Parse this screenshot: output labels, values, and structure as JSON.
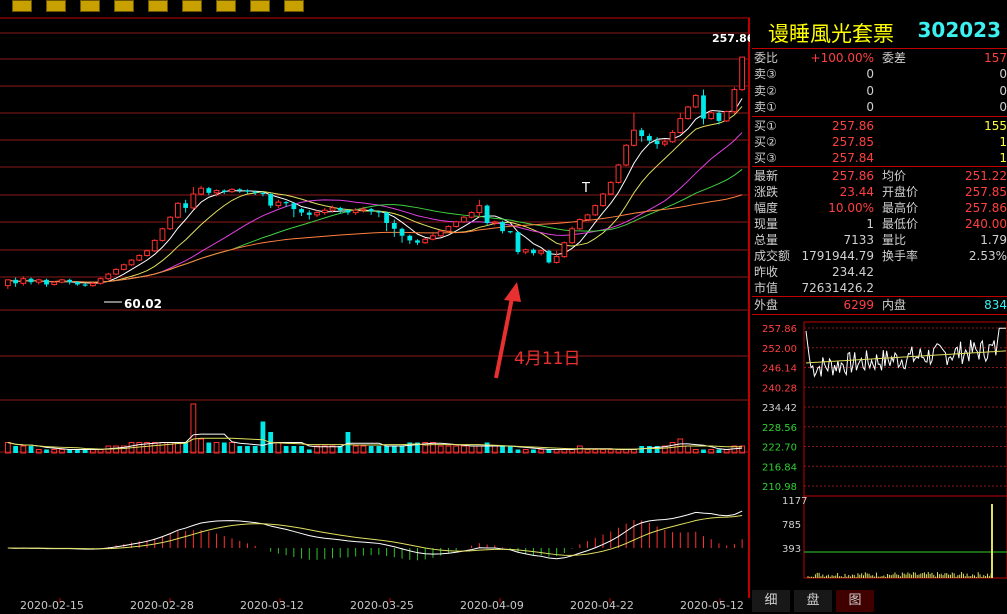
{
  "toolbar": {
    "buttons": [
      "1",
      "3",
      "5",
      "15",
      "30",
      "60",
      "日",
      "周",
      "月"
    ]
  },
  "chart_data": [
    {
      "type": "candlestick",
      "title": "",
      "x_ticks": [
        "2020-02-15",
        "2020-02-28",
        "2020-03-12",
        "2020-03-25",
        "2020-04-09",
        "2020-04-22",
        "2020-05-12"
      ],
      "annotations": {
        "low_label": "60.02",
        "high_label": "257.86",
        "arrow_text": "4月11日",
        "t_mark": "T"
      },
      "ylim": [
        40,
        290
      ],
      "candles": [
        [
          61,
          66,
          58,
          65
        ],
        [
          66,
          63,
          60,
          68
        ],
        [
          63,
          67,
          61,
          69
        ],
        [
          67,
          64,
          62,
          68
        ],
        [
          64,
          66,
          62,
          67
        ],
        [
          66,
          62,
          60,
          67
        ],
        [
          62,
          64,
          61,
          65
        ],
        [
          64,
          66,
          63,
          67
        ],
        [
          66,
          64,
          62,
          67
        ],
        [
          64,
          62,
          61,
          65
        ],
        [
          62,
          61,
          60,
          63
        ],
        [
          61,
          63,
          60,
          64
        ],
        [
          63,
          67,
          62,
          68
        ],
        [
          67,
          71,
          66,
          72
        ],
        [
          71,
          75,
          70,
          76
        ],
        [
          75,
          79,
          74,
          80
        ],
        [
          79,
          83,
          78,
          84
        ],
        [
          83,
          87,
          82,
          88
        ],
        [
          87,
          91,
          86,
          92
        ],
        [
          91,
          100,
          90,
          101
        ],
        [
          100,
          110,
          99,
          111
        ],
        [
          110,
          120,
          109,
          121
        ],
        [
          120,
          132,
          119,
          133
        ],
        [
          132,
          128,
          124,
          135
        ],
        [
          128,
          140,
          127,
          146
        ],
        [
          140,
          145,
          139,
          147
        ],
        [
          145,
          141,
          139,
          146
        ],
        [
          141,
          143,
          138,
          144
        ],
        [
          143,
          142,
          140,
          144
        ],
        [
          142,
          144,
          141,
          145
        ],
        [
          144,
          143,
          141,
          145
        ],
        [
          143,
          142,
          140,
          144
        ],
        [
          142,
          141,
          139,
          143
        ],
        [
          141,
          140,
          138,
          142
        ],
        [
          140,
          130,
          128,
          141
        ],
        [
          130,
          133,
          128,
          135
        ],
        [
          133,
          132,
          129,
          134
        ],
        [
          132,
          127,
          120,
          133
        ],
        [
          127,
          124,
          121,
          128
        ],
        [
          124,
          122,
          118,
          126
        ],
        [
          122,
          124,
          120,
          126
        ],
        [
          124,
          126,
          122,
          128
        ],
        [
          126,
          128,
          124,
          130
        ],
        [
          128,
          126,
          123,
          129
        ],
        [
          126,
          124,
          122,
          127
        ],
        [
          124,
          126,
          122,
          128
        ],
        [
          126,
          127,
          124,
          129
        ],
        [
          127,
          125,
          122,
          128
        ],
        [
          125,
          124,
          120,
          126
        ],
        [
          124,
          115,
          108,
          125
        ],
        [
          115,
          110,
          103,
          118
        ],
        [
          110,
          104,
          98,
          111
        ],
        [
          104,
          100,
          97,
          105
        ],
        [
          100,
          98,
          96,
          101
        ],
        [
          98,
          101,
          97,
          102
        ],
        [
          101,
          104,
          100,
          106
        ],
        [
          104,
          108,
          103,
          109
        ],
        [
          108,
          112,
          107,
          113
        ],
        [
          112,
          116,
          111,
          117
        ],
        [
          116,
          120,
          115,
          121
        ],
        [
          120,
          124,
          119,
          125
        ],
        [
          124,
          130,
          120,
          135
        ],
        [
          130,
          115,
          113,
          131
        ],
        [
          115,
          116,
          113,
          117
        ],
        [
          116,
          108,
          106,
          117
        ],
        [
          108,
          107,
          106,
          108
        ],
        [
          107,
          90,
          88,
          108
        ],
        [
          90,
          92,
          88,
          93
        ],
        [
          92,
          89,
          87,
          93
        ],
        [
          89,
          91,
          87,
          92
        ],
        [
          91,
          81,
          80,
          92
        ],
        [
          81,
          86,
          80,
          91
        ],
        [
          86,
          98,
          85,
          99
        ],
        [
          98,
          110,
          97,
          112
        ],
        [
          110,
          118,
          109,
          119
        ],
        [
          118,
          122,
          117,
          123
        ],
        [
          122,
          130,
          121,
          131
        ],
        [
          130,
          140,
          129,
          141
        ],
        [
          140,
          150,
          139,
          151
        ],
        [
          150,
          165,
          149,
          166
        ],
        [
          165,
          182,
          164,
          183
        ],
        [
          182,
          195,
          181,
          210
        ],
        [
          195,
          190,
          185,
          197
        ],
        [
          190,
          186,
          183,
          192
        ],
        [
          186,
          183,
          179,
          189
        ],
        [
          183,
          185,
          181,
          187
        ],
        [
          185,
          193,
          184,
          195
        ],
        [
          193,
          205,
          192,
          210
        ],
        [
          205,
          215,
          204,
          216
        ],
        [
          215,
          225,
          214,
          226
        ],
        [
          225,
          205,
          200,
          230
        ],
        [
          205,
          210,
          204,
          212
        ],
        [
          210,
          203,
          200,
          211
        ],
        [
          203,
          211,
          202,
          212
        ],
        [
          211,
          230,
          209,
          232
        ],
        [
          230,
          258,
          229,
          258
        ]
      ],
      "volume": [
        3,
        2,
        2,
        2,
        1,
        1,
        1,
        1,
        1,
        1,
        1,
        1,
        1,
        2,
        2,
        2,
        3,
        3,
        3,
        3,
        3,
        3,
        3,
        3,
        14,
        4,
        3,
        3,
        3,
        3,
        2,
        2,
        2,
        2,
        6,
        3,
        2,
        2,
        2,
        1,
        2,
        2,
        2,
        2,
        6,
        2,
        2,
        2,
        2,
        2,
        2,
        2,
        3,
        3,
        3,
        3,
        2,
        2,
        2,
        2,
        2,
        2,
        2,
        2,
        2,
        2,
        1,
        1,
        1,
        1,
        1,
        1,
        1,
        1,
        2,
        1,
        1,
        1,
        1,
        1,
        1,
        1,
        2,
        2,
        2,
        2,
        3,
        4,
        2,
        1,
        1,
        1,
        1,
        1,
        2,
        2
      ],
      "volume_highlights": {
        "24": 14,
        "33": 9,
        "62": 3
      }
    },
    {
      "type": "line",
      "title": "",
      "intraday_y_ticks": [
        "257.86",
        "252.00",
        "246.14",
        "240.28",
        "234.42",
        "228.56",
        "222.70",
        "216.84",
        "210.98"
      ],
      "intraday_vol_ticks": [
        "1177",
        "785",
        "393"
      ]
    }
  ],
  "quote": {
    "name": "谩睡風光套票",
    "code": "302023",
    "rows": [
      {
        "l1": "委比",
        "v1": "+100.00%",
        "c1": "#ff4040",
        "l2": "委差",
        "v2": "157",
        "c2": "#ff4040"
      },
      {
        "l1": "卖③",
        "v1": "0",
        "c1": "#d0d0d0",
        "l2": "",
        "v2": "0",
        "c2": "#d0d0d0"
      },
      {
        "l1": "卖②",
        "v1": "0",
        "c1": "#d0d0d0",
        "l2": "",
        "v2": "0",
        "c2": "#d0d0d0"
      },
      {
        "l1": "卖①",
        "v1": "0",
        "c1": "#d0d0d0",
        "l2": "",
        "v2": "0",
        "c2": "#d0d0d0"
      },
      {
        "l1": "买①",
        "v1": "257.86",
        "c1": "#ff4040",
        "l2": "",
        "v2": "155",
        "c2": "#ffff40"
      },
      {
        "l1": "买②",
        "v1": "257.85",
        "c1": "#ff4040",
        "l2": "",
        "v2": "1",
        "c2": "#ffff40"
      },
      {
        "l1": "买③",
        "v1": "257.84",
        "c1": "#ff4040",
        "l2": "",
        "v2": "1",
        "c2": "#ffff40"
      },
      {
        "l1": "最新",
        "v1": "257.86",
        "c1": "#ff4040",
        "l2": "均价",
        "v2": "251.22",
        "c2": "#ff4040"
      },
      {
        "l1": "涨跌",
        "v1": "23.44",
        "c1": "#ff4040",
        "l2": "开盘价",
        "v2": "257.85",
        "c2": "#ff4040"
      },
      {
        "l1": "幅度",
        "v1": "10.00%",
        "c1": "#ff4040",
        "l2": "最高价",
        "v2": "257.86",
        "c2": "#ff4040"
      },
      {
        "l1": "现量",
        "v1": "1",
        "c1": "#d0d0d0",
        "l2": "最低价",
        "v2": "240.00",
        "c2": "#ff4040"
      },
      {
        "l1": "总量",
        "v1": "7133",
        "c1": "#d0d0d0",
        "l2": "量比",
        "v2": "1.79",
        "c2": "#d0d0d0"
      },
      {
        "l1": "成交额",
        "v1": "1791944.79",
        "c1": "#d0d0d0",
        "l2": "换手率",
        "v2": "2.53%",
        "c2": "#d0d0d0"
      },
      {
        "l1": "昨收",
        "v1": "234.42",
        "c1": "#d0d0d0",
        "l2": "",
        "v2": "",
        "c2": "#d0d0d0"
      },
      {
        "l1": "市值",
        "v1": "72631426.2",
        "c1": "#d0d0d0",
        "l2": "",
        "v2": "",
        "c2": "#d0d0d0"
      },
      {
        "l1": "外盘",
        "v1": "6299",
        "c1": "#ff4040",
        "l2": "内盘",
        "v2": "834",
        "c2": "#3cf0f0"
      }
    ]
  },
  "tabs": [
    "细",
    "盘",
    "图"
  ],
  "colors": {
    "up": "#ff3030",
    "down": "#00e8e8",
    "grid": "#8b1a1a",
    "panel": "#c00000"
  }
}
